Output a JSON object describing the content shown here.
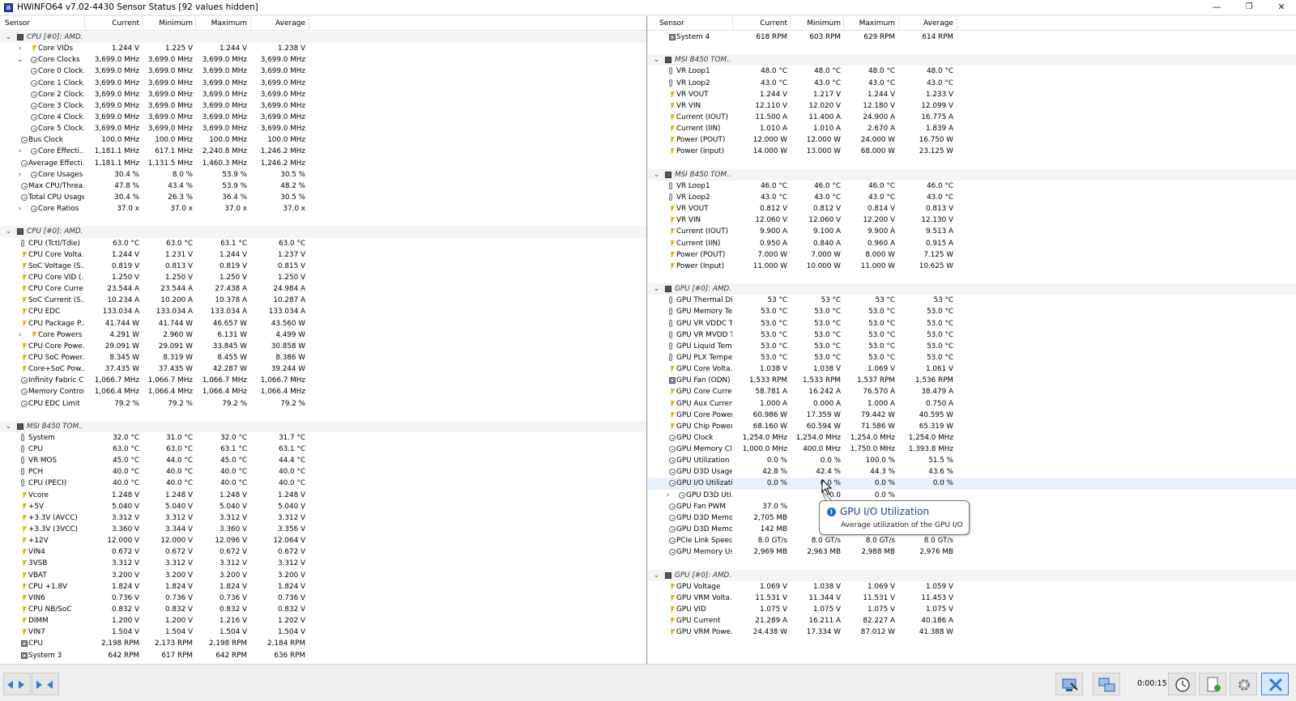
{
  "window": {
    "title": "HWiNFO64 v7.02-4430 Sensor Status [92 values hidden]",
    "min_glyph": "—",
    "max_glyph": "❐",
    "close_glyph": "✕"
  },
  "columns": [
    "Sensor",
    "Current",
    "Minimum",
    "Maximum",
    "Average"
  ],
  "left_rows": [
    {
      "t": "g",
      "e": "v",
      "l": "CPU [#0]: AMD..."
    },
    {
      "t": "r",
      "x": 1,
      "e": ">",
      "i": "bolt",
      "l": "Core VIDs",
      "v": [
        "1.244 V",
        "1.225 V",
        "1.244 V",
        "1.238 V"
      ]
    },
    {
      "t": "r",
      "x": 1,
      "e": "v",
      "i": "clock",
      "l": "Core Clocks",
      "v": [
        "3,699.0 MHz",
        "3,699.0 MHz",
        "3,699.0 MHz",
        "3,699.0 MHz"
      ]
    },
    {
      "t": "r",
      "x": 2,
      "i": "clock",
      "l": "Core 0 Clock...",
      "v": [
        "3,699.0 MHz",
        "3,699.0 MHz",
        "3,699.0 MHz",
        "3,699.0 MHz"
      ]
    },
    {
      "t": "r",
      "x": 2,
      "i": "clock",
      "l": "Core 1 Clock...",
      "v": [
        "3,699.0 MHz",
        "3,699.0 MHz",
        "3,699.0 MHz",
        "3,699.0 MHz"
      ]
    },
    {
      "t": "r",
      "x": 2,
      "i": "clock",
      "l": "Core 2 Clock...",
      "v": [
        "3,699.0 MHz",
        "3,699.0 MHz",
        "3,699.0 MHz",
        "3,699.0 MHz"
      ]
    },
    {
      "t": "r",
      "x": 2,
      "i": "clock",
      "l": "Core 3 Clock...",
      "v": [
        "3,699.0 MHz",
        "3,699.0 MHz",
        "3,699.0 MHz",
        "3,699.0 MHz"
      ]
    },
    {
      "t": "r",
      "x": 2,
      "i": "clock",
      "l": "Core 4 Clock...",
      "v": [
        "3,699.0 MHz",
        "3,699.0 MHz",
        "3,699.0 MHz",
        "3,699.0 MHz"
      ]
    },
    {
      "t": "r",
      "x": 2,
      "i": "clock",
      "l": "Core 5 Clock...",
      "v": [
        "3,699.0 MHz",
        "3,699.0 MHz",
        "3,699.0 MHz",
        "3,699.0 MHz"
      ]
    },
    {
      "t": "r",
      "x": 0,
      "i": "clock",
      "l": "Bus Clock",
      "v": [
        "100.0 MHz",
        "100.0 MHz",
        "100.0 MHz",
        "100.0 MHz"
      ]
    },
    {
      "t": "r",
      "x": 1,
      "e": ">",
      "i": "clock",
      "l": "Core Effecti...",
      "v": [
        "1,181.1 MHz",
        "617.1 MHz",
        "2,240.8 MHz",
        "1,246.2 MHz"
      ]
    },
    {
      "t": "r",
      "x": 0,
      "i": "clock",
      "l": "Average Effecti...",
      "v": [
        "1,181.1 MHz",
        "1,131.5 MHz",
        "1,460.3 MHz",
        "1,246.2 MHz"
      ]
    },
    {
      "t": "r",
      "x": 1,
      "e": ">",
      "i": "clock",
      "l": "Core Usages",
      "v": [
        "30.4 %",
        "8.0 %",
        "53.9 %",
        "30.5 %"
      ]
    },
    {
      "t": "r",
      "x": 0,
      "i": "clock",
      "l": "Max CPU/Threa...",
      "v": [
        "47.8 %",
        "43.4 %",
        "53.9 %",
        "48.2 %"
      ]
    },
    {
      "t": "r",
      "x": 0,
      "i": "clock",
      "l": "Total CPU Usage",
      "v": [
        "30.4 %",
        "26.3 %",
        "36.4 %",
        "30.5 %"
      ]
    },
    {
      "t": "r",
      "x": 1,
      "e": ">",
      "i": "clock",
      "l": "Core Ratios",
      "v": [
        "37.0 x",
        "37.0 x",
        "37.0 x",
        "37.0 x"
      ]
    },
    {
      "t": "b"
    },
    {
      "t": "g",
      "e": "v",
      "l": "CPU [#0]: AMD..."
    },
    {
      "t": "r",
      "x": 0,
      "i": "therm",
      "l": "CPU (Tctl/Tdie)",
      "v": [
        "63.0 °C",
        "63.0 °C",
        "63.1 °C",
        "63.0 °C"
      ]
    },
    {
      "t": "r",
      "x": 0,
      "i": "bolt",
      "l": "CPU Core Volta...",
      "v": [
        "1.244 V",
        "1.231 V",
        "1.244 V",
        "1.237 V"
      ]
    },
    {
      "t": "r",
      "x": 0,
      "i": "bolt",
      "l": "SoC Voltage (S...",
      "v": [
        "0.819 V",
        "0.813 V",
        "0.819 V",
        "0.815 V"
      ]
    },
    {
      "t": "r",
      "x": 0,
      "i": "bolt",
      "l": "CPU Core VID (...",
      "v": [
        "1.250 V",
        "1.250 V",
        "1.250 V",
        "1.250 V"
      ]
    },
    {
      "t": "r",
      "x": 0,
      "i": "bolt",
      "l": "CPU Core Curre...",
      "v": [
        "23.544 A",
        "23.544 A",
        "27.438 A",
        "24.984 A"
      ]
    },
    {
      "t": "r",
      "x": 0,
      "i": "bolt",
      "l": "SoC Current (S...",
      "v": [
        "10.234 A",
        "10.200 A",
        "10.378 A",
        "10.287 A"
      ]
    },
    {
      "t": "r",
      "x": 0,
      "i": "bolt",
      "l": "CPU EDC",
      "v": [
        "133.034 A",
        "133.034 A",
        "133.034 A",
        "133.034 A"
      ]
    },
    {
      "t": "r",
      "x": 0,
      "i": "bolt",
      "l": "CPU Package P...",
      "v": [
        "41.744 W",
        "41.744 W",
        "46.657 W",
        "43.560 W"
      ]
    },
    {
      "t": "r",
      "x": 1,
      "e": ">",
      "i": "bolt",
      "l": "Core Powers",
      "v": [
        "4.291 W",
        "2.960 W",
        "6.131 W",
        "4.499 W"
      ]
    },
    {
      "t": "r",
      "x": 0,
      "i": "bolt",
      "l": "CPU Core Powe...",
      "v": [
        "29.091 W",
        "29.091 W",
        "33.845 W",
        "30.858 W"
      ]
    },
    {
      "t": "r",
      "x": 0,
      "i": "bolt",
      "l": "CPU SoC Power...",
      "v": [
        "8.345 W",
        "8.319 W",
        "8.455 W",
        "8.386 W"
      ]
    },
    {
      "t": "r",
      "x": 0,
      "i": "bolt",
      "l": "Core+SoC Pow...",
      "v": [
        "37.435 W",
        "37.435 W",
        "42.287 W",
        "39.244 W"
      ]
    },
    {
      "t": "r",
      "x": 0,
      "i": "clock",
      "l": "Infinity Fabric C...",
      "v": [
        "1,066.7 MHz",
        "1,066.7 MHz",
        "1,066.7 MHz",
        "1,066.7 MHz"
      ]
    },
    {
      "t": "r",
      "x": 0,
      "i": "clock",
      "l": "Memory Control...",
      "v": [
        "1,066.4 MHz",
        "1,066.4 MHz",
        "1,066.4 MHz",
        "1,066.4 MHz"
      ]
    },
    {
      "t": "r",
      "x": 0,
      "i": "clock",
      "l": "CPU EDC Limit",
      "v": [
        "79.2 %",
        "79.2 %",
        "79.2 %",
        "79.2 %"
      ]
    },
    {
      "t": "b"
    },
    {
      "t": "g",
      "e": "v",
      "l": "MSI B450 TOM..."
    },
    {
      "t": "r",
      "x": 0,
      "i": "therm",
      "l": "System",
      "v": [
        "32.0 °C",
        "31.0 °C",
        "32.0 °C",
        "31.7 °C"
      ]
    },
    {
      "t": "r",
      "x": 0,
      "i": "therm",
      "l": "CPU",
      "v": [
        "63.0 °C",
        "63.0 °C",
        "63.1 °C",
        "63.1 °C"
      ]
    },
    {
      "t": "r",
      "x": 0,
      "i": "therm",
      "l": "VR MOS",
      "v": [
        "45.0 °C",
        "44.0 °C",
        "45.0 °C",
        "44.4 °C"
      ]
    },
    {
      "t": "r",
      "x": 0,
      "i": "therm",
      "l": "PCH",
      "v": [
        "40.0 °C",
        "40.0 °C",
        "40.0 °C",
        "40.0 °C"
      ]
    },
    {
      "t": "r",
      "x": 0,
      "i": "therm",
      "l": "CPU (PECI)",
      "v": [
        "40.0 °C",
        "40.0 °C",
        "40.0 °C",
        "40.0 °C"
      ]
    },
    {
      "t": "r",
      "x": 0,
      "i": "bolt",
      "l": "Vcore",
      "v": [
        "1.248 V",
        "1.248 V",
        "1.248 V",
        "1.248 V"
      ]
    },
    {
      "t": "r",
      "x": 0,
      "i": "bolt",
      "l": "+5V",
      "v": [
        "5.040 V",
        "5.040 V",
        "5.040 V",
        "5.040 V"
      ]
    },
    {
      "t": "r",
      "x": 0,
      "i": "bolt",
      "l": "+3.3V (AVCC)",
      "v": [
        "3.312 V",
        "3.312 V",
        "3.312 V",
        "3.312 V"
      ]
    },
    {
      "t": "r",
      "x": 0,
      "i": "bolt",
      "l": "+3.3V (3VCC)",
      "v": [
        "3.360 V",
        "3.344 V",
        "3.360 V",
        "3.356 V"
      ]
    },
    {
      "t": "r",
      "x": 0,
      "i": "bolt",
      "l": "+12V",
      "v": [
        "12.000 V",
        "12.000 V",
        "12.096 V",
        "12.064 V"
      ]
    },
    {
      "t": "r",
      "x": 0,
      "i": "bolt",
      "l": "VIN4",
      "v": [
        "0.672 V",
        "0.672 V",
        "0.672 V",
        "0.672 V"
      ]
    },
    {
      "t": "r",
      "x": 0,
      "i": "bolt",
      "l": "3VSB",
      "v": [
        "3.312 V",
        "3.312 V",
        "3.312 V",
        "3.312 V"
      ]
    },
    {
      "t": "r",
      "x": 0,
      "i": "bolt",
      "l": "VBAT",
      "v": [
        "3.200 V",
        "3.200 V",
        "3.200 V",
        "3.200 V"
      ]
    },
    {
      "t": "r",
      "x": 0,
      "i": "bolt",
      "l": "CPU +1.8V",
      "v": [
        "1.824 V",
        "1.824 V",
        "1.824 V",
        "1.824 V"
      ]
    },
    {
      "t": "r",
      "x": 0,
      "i": "bolt",
      "l": "VIN6",
      "v": [
        "0.736 V",
        "0.736 V",
        "0.736 V",
        "0.736 V"
      ]
    },
    {
      "t": "r",
      "x": 0,
      "i": "bolt",
      "l": "CPU NB/SoC",
      "v": [
        "0.832 V",
        "0.832 V",
        "0.832 V",
        "0.832 V"
      ]
    },
    {
      "t": "r",
      "x": 0,
      "i": "bolt",
      "l": "DIMM",
      "v": [
        "1.200 V",
        "1.200 V",
        "1.216 V",
        "1.202 V"
      ]
    },
    {
      "t": "r",
      "x": 0,
      "i": "bolt",
      "l": "VIN7",
      "v": [
        "1.504 V",
        "1.504 V",
        "1.504 V",
        "1.504 V"
      ]
    },
    {
      "t": "r",
      "x": 0,
      "i": "fan",
      "l": "CPU",
      "v": [
        "2,198 RPM",
        "2,173 RPM",
        "2,198 RPM",
        "2,184 RPM"
      ]
    },
    {
      "t": "r",
      "x": 0,
      "i": "fan",
      "l": "System 3",
      "v": [
        "642 RPM",
        "617 RPM",
        "642 RPM",
        "636 RPM"
      ]
    }
  ],
  "right_rows": [
    {
      "t": "r",
      "x": 0,
      "i": "fan",
      "l": "System 4",
      "v": [
        "618 RPM",
        "603 RPM",
        "629 RPM",
        "614 RPM"
      ]
    },
    {
      "t": "b"
    },
    {
      "t": "g",
      "e": "v",
      "l": "MSI B450 TOM..."
    },
    {
      "t": "r",
      "x": 0,
      "i": "therm",
      "l": "VR Loop1",
      "v": [
        "48.0 °C",
        "48.0 °C",
        "48.0 °C",
        "48.0 °C"
      ]
    },
    {
      "t": "r",
      "x": 0,
      "i": "therm",
      "l": "VR Loop2",
      "v": [
        "43.0 °C",
        "43.0 °C",
        "43.0 °C",
        "43.0 °C"
      ]
    },
    {
      "t": "r",
      "x": 0,
      "i": "bolt",
      "l": "VR VOUT",
      "v": [
        "1.244 V",
        "1.217 V",
        "1.244 V",
        "1.233 V"
      ]
    },
    {
      "t": "r",
      "x": 0,
      "i": "bolt",
      "l": "VR VIN",
      "v": [
        "12.110 V",
        "12.020 V",
        "12.180 V",
        "12.099 V"
      ]
    },
    {
      "t": "r",
      "x": 0,
      "i": "bolt",
      "l": "Current (IOUT)",
      "v": [
        "11.500 A",
        "11.400 A",
        "24.900 A",
        "16.775 A"
      ]
    },
    {
      "t": "r",
      "x": 0,
      "i": "bolt",
      "l": "Current (IIN)",
      "v": [
        "1.010 A",
        "1.010 A",
        "2.670 A",
        "1.839 A"
      ]
    },
    {
      "t": "r",
      "x": 0,
      "i": "bolt",
      "l": "Power (POUT)",
      "v": [
        "12.000 W",
        "12.000 W",
        "24.000 W",
        "16.750 W"
      ]
    },
    {
      "t": "r",
      "x": 0,
      "i": "bolt",
      "l": "Power (Input)",
      "v": [
        "14.000 W",
        "13.000 W",
        "68.000 W",
        "23.125 W"
      ]
    },
    {
      "t": "b"
    },
    {
      "t": "g",
      "e": "v",
      "l": "MSI B450 TOM..."
    },
    {
      "t": "r",
      "x": 0,
      "i": "therm",
      "l": "VR Loop1",
      "v": [
        "46.0 °C",
        "46.0 °C",
        "46.0 °C",
        "46.0 °C"
      ]
    },
    {
      "t": "r",
      "x": 0,
      "i": "therm",
      "l": "VR Loop2",
      "v": [
        "43.0 °C",
        "43.0 °C",
        "43.0 °C",
        "43.0 °C"
      ]
    },
    {
      "t": "r",
      "x": 0,
      "i": "bolt",
      "l": "VR VOUT",
      "v": [
        "0.812 V",
        "0.812 V",
        "0.814 V",
        "0.813 V"
      ]
    },
    {
      "t": "r",
      "x": 0,
      "i": "bolt",
      "l": "VR VIN",
      "v": [
        "12.060 V",
        "12.060 V",
        "12.200 V",
        "12.130 V"
      ]
    },
    {
      "t": "r",
      "x": 0,
      "i": "bolt",
      "l": "Current (IOUT)",
      "v": [
        "9.900 A",
        "9.100 A",
        "9.900 A",
        "9.513 A"
      ]
    },
    {
      "t": "r",
      "x": 0,
      "i": "bolt",
      "l": "Current (IIN)",
      "v": [
        "0.950 A",
        "0.840 A",
        "0.960 A",
        "0.915 A"
      ]
    },
    {
      "t": "r",
      "x": 0,
      "i": "bolt",
      "l": "Power (POUT)",
      "v": [
        "7.000 W",
        "7.000 W",
        "8.000 W",
        "7.125 W"
      ]
    },
    {
      "t": "r",
      "x": 0,
      "i": "bolt",
      "l": "Power (Input)",
      "v": [
        "11.000 W",
        "10.000 W",
        "11.000 W",
        "10.625 W"
      ]
    },
    {
      "t": "b"
    },
    {
      "t": "g",
      "e": "v",
      "l": "GPU [#0]: AMD..."
    },
    {
      "t": "r",
      "x": 0,
      "i": "therm",
      "l": "GPU Thermal Di...",
      "v": [
        "53 °C",
        "53 °C",
        "53 °C",
        "53 °C"
      ]
    },
    {
      "t": "r",
      "x": 0,
      "i": "therm",
      "l": "GPU Memory Te...",
      "v": [
        "53.0 °C",
        "53.0 °C",
        "53.0 °C",
        "53.0 °C"
      ]
    },
    {
      "t": "r",
      "x": 0,
      "i": "therm",
      "l": "GPU VR VDDC T...",
      "v": [
        "53.0 °C",
        "53.0 °C",
        "53.0 °C",
        "53.0 °C"
      ]
    },
    {
      "t": "r",
      "x": 0,
      "i": "therm",
      "l": "GPU VR MVDD T...",
      "v": [
        "53.0 °C",
        "53.0 °C",
        "53.0 °C",
        "53.0 °C"
      ]
    },
    {
      "t": "r",
      "x": 0,
      "i": "therm",
      "l": "GPU Liquid Tem...",
      "v": [
        "53.0 °C",
        "53.0 °C",
        "53.0 °C",
        "53.0 °C"
      ]
    },
    {
      "t": "r",
      "x": 0,
      "i": "therm",
      "l": "GPU PLX Tempe...",
      "v": [
        "53.0 °C",
        "53.0 °C",
        "53.0 °C",
        "53.0 °C"
      ]
    },
    {
      "t": "r",
      "x": 0,
      "i": "bolt",
      "l": "GPU Core Volta...",
      "v": [
        "1.038 V",
        "1.038 V",
        "1.069 V",
        "1.061 V"
      ]
    },
    {
      "t": "r",
      "x": 0,
      "i": "fan",
      "l": "GPU Fan (ODN)",
      "v": [
        "1,533 RPM",
        "1,533 RPM",
        "1,537 RPM",
        "1,536 RPM"
      ]
    },
    {
      "t": "r",
      "x": 0,
      "i": "bolt",
      "l": "GPU Core Curre...",
      "v": [
        "58.781 A",
        "16.242 A",
        "76.570 A",
        "38.479 A"
      ]
    },
    {
      "t": "r",
      "x": 0,
      "i": "bolt",
      "l": "GPU Aux Current",
      "v": [
        "1.000 A",
        "0.000 A",
        "1.000 A",
        "0.750 A"
      ]
    },
    {
      "t": "r",
      "x": 0,
      "i": "bolt",
      "l": "GPU Core Power",
      "v": [
        "60.986 W",
        "17.359 W",
        "79.442 W",
        "40.595 W"
      ]
    },
    {
      "t": "r",
      "x": 0,
      "i": "bolt",
      "l": "GPU Chip Power",
      "v": [
        "68.160 W",
        "60.594 W",
        "71.586 W",
        "65.319 W"
      ]
    },
    {
      "t": "r",
      "x": 0,
      "i": "clock",
      "l": "GPU Clock",
      "v": [
        "1,254.0 MHz",
        "1,254.0 MHz",
        "1,254.0 MHz",
        "1,254.0 MHz"
      ]
    },
    {
      "t": "r",
      "x": 0,
      "i": "clock",
      "l": "GPU Memory Cl...",
      "v": [
        "1,000.0 MHz",
        "400.0 MHz",
        "1,750.0 MHz",
        "1,393.8 MHz"
      ]
    },
    {
      "t": "r",
      "x": 0,
      "i": "clock",
      "l": "GPU Utilization",
      "v": [
        "0.0 %",
        "0.0 %",
        "100.0 %",
        "51.5 %"
      ]
    },
    {
      "t": "r",
      "x": 0,
      "i": "clock",
      "l": "GPU D3D Usage",
      "v": [
        "42.8 %",
        "42.4 %",
        "44.3 %",
        "43.6 %"
      ]
    },
    {
      "t": "r",
      "x": 0,
      "i": "clock",
      "l": "GPU I/O Utilization",
      "v": [
        "0.0 %",
        "0.0 %",
        "0.0 %",
        "0.0 %"
      ],
      "hl": true
    },
    {
      "t": "r",
      "x": 1,
      "e": ">",
      "i": "clock",
      "l": "GPU D3D Uti...",
      "v": [
        "",
        "0.0",
        "0.0 %",
        ""
      ]
    },
    {
      "t": "r",
      "x": 0,
      "i": "clock",
      "l": "GPU Fan PWM",
      "v": [
        "37.0 %",
        "",
        "",
        ""
      ]
    },
    {
      "t": "r",
      "x": 0,
      "i": "clock",
      "l": "GPU D3D Memo...",
      "v": [
        "2,705 MB",
        "2,",
        "",
        ""
      ]
    },
    {
      "t": "r",
      "x": 0,
      "i": "clock",
      "l": "GPU D3D Memo...",
      "v": [
        "142 MB",
        "",
        "",
        ""
      ]
    },
    {
      "t": "r",
      "x": 0,
      "i": "clock",
      "l": "PCIe Link Speed",
      "v": [
        "8.0 GT/s",
        "8.0 GT/s",
        "8.0 GT/s",
        "8.0 GT/s"
      ]
    },
    {
      "t": "r",
      "x": 0,
      "i": "clock",
      "l": "GPU Memory Us...",
      "v": [
        "2,969 MB",
        "2,963 MB",
        "2,988 MB",
        "2,976 MB"
      ]
    },
    {
      "t": "b"
    },
    {
      "t": "g",
      "e": "v",
      "l": "GPU [#0]: AMD..."
    },
    {
      "t": "r",
      "x": 0,
      "i": "bolt",
      "l": "GPU Voltage",
      "v": [
        "1.069 V",
        "1.038 V",
        "1.069 V",
        "1.059 V"
      ]
    },
    {
      "t": "r",
      "x": 0,
      "i": "bolt",
      "l": "GPU VRM Volta...",
      "v": [
        "11.531 V",
        "11.344 V",
        "11.531 V",
        "11.453 V"
      ]
    },
    {
      "t": "r",
      "x": 0,
      "i": "bolt",
      "l": "GPU VID",
      "v": [
        "1.075 V",
        "1.075 V",
        "1.075 V",
        "1.075 V"
      ]
    },
    {
      "t": "r",
      "x": 0,
      "i": "bolt",
      "l": "GPU Current",
      "v": [
        "21.289 A",
        "16.211 A",
        "82.227 A",
        "40.186 A"
      ]
    },
    {
      "t": "r",
      "x": 0,
      "i": "bolt",
      "l": "GPU VRM Powe...",
      "v": [
        "24.438 W",
        "17.334 W",
        "87.012 W",
        "41.388 W"
      ]
    }
  ],
  "tooltip": {
    "title": "GPU I/O Utilization",
    "description": "Average utilization of the GPU I/O",
    "icon": "info-icon"
  },
  "statusbar": {
    "timer": "0:00:15"
  },
  "colors": {
    "accent": "#2e7ad6",
    "tooltip_title": "#1b3f91",
    "highlight_row": "#e8f1fb"
  }
}
